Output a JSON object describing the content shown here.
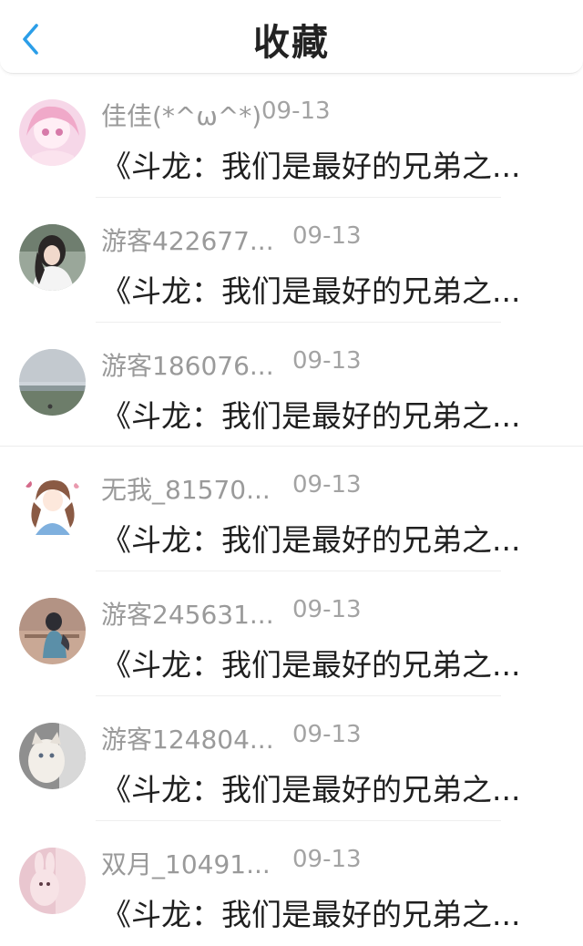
{
  "header": {
    "title": "收藏",
    "back_icon": "chevron-left-icon",
    "accent_color": "#2b9ee8"
  },
  "items": [
    {
      "name": "佳佳(*^ω^*)",
      "date": "09-13",
      "snippet": "《斗龙：我们是最好的兄弟之..."
    },
    {
      "name": "游客422677...",
      "date": "09-13",
      "snippet": "《斗龙：我们是最好的兄弟之..."
    },
    {
      "name": "游客186076...",
      "date": "09-13",
      "snippet": "《斗龙：我们是最好的兄弟之..."
    },
    {
      "name": "无我_81570...",
      "date": "09-13",
      "snippet": "《斗龙：我们是最好的兄弟之..."
    },
    {
      "name": "游客245631...",
      "date": "09-13",
      "snippet": "《斗龙：我们是最好的兄弟之..."
    },
    {
      "name": "游客124804...",
      "date": "09-13",
      "snippet": "《斗龙：我们是最好的兄弟之..."
    },
    {
      "name": "双月_10491...",
      "date": "09-13",
      "snippet": "《斗龙：我们是最好的兄弟之..."
    }
  ]
}
